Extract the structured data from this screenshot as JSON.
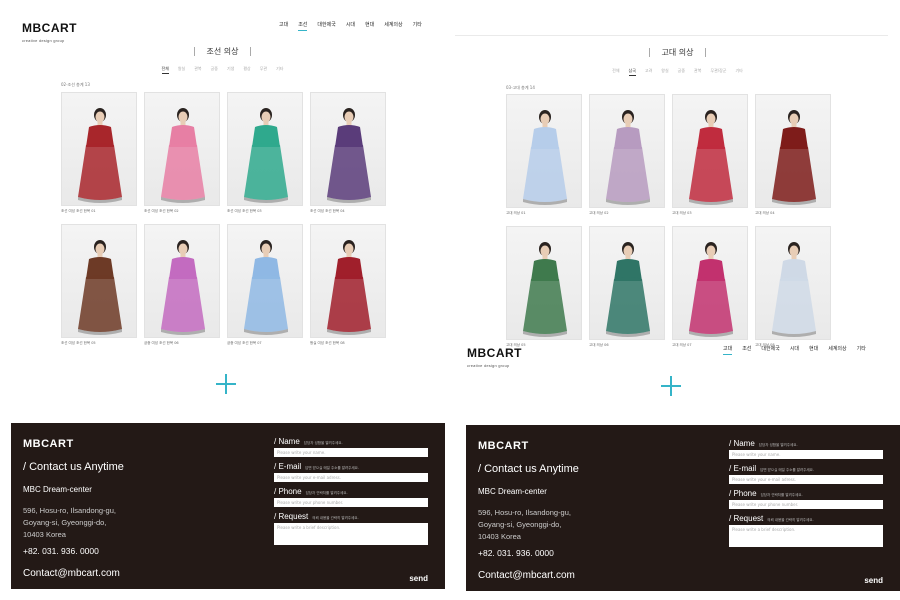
{
  "left": {
    "logo": {
      "brand": "MBCART",
      "sub": "creative design group"
    },
    "nav": [
      {
        "label": "고대",
        "active": false
      },
      {
        "label": "조선",
        "active": true
      },
      {
        "label": "대한제국",
        "active": false
      },
      {
        "label": "시대",
        "active": false
      },
      {
        "label": "현대",
        "active": false
      },
      {
        "label": "세계의상",
        "active": false
      },
      {
        "label": "기타",
        "active": false
      }
    ],
    "page_title": "조선 의상",
    "sub_tabs": [
      {
        "label": "전체",
        "active": true
      },
      {
        "label": "왕실",
        "active": false
      },
      {
        "label": "관복",
        "active": false
      },
      {
        "label": "궁중",
        "active": false
      },
      {
        "label": "기생",
        "active": false
      },
      {
        "label": "평상",
        "active": false
      },
      {
        "label": "무관",
        "active": false
      },
      {
        "label": "기타",
        "active": false
      }
    ],
    "count": "02-조선 총계 13",
    "items": [
      {
        "caption": "조선 여성 조선 한복 01",
        "color": "#a8262b"
      },
      {
        "caption": "조선 여성 조선 한복 02",
        "color": "#e77fa4"
      },
      {
        "caption": "조선 여성 조선 한복 03",
        "color": "#2fa98d"
      },
      {
        "caption": "조선 여성 조선 한복 04",
        "color": "#5a3c7a"
      },
      {
        "caption": "조선 여성 조선 한복 05",
        "color": "#6d3a26"
      },
      {
        "caption": "궁중 여성 조선 한복 06",
        "color": "#c36bc0"
      },
      {
        "caption": "궁중 여성 조선 한복 07",
        "color": "#8fb8e4"
      },
      {
        "caption": "왕실 여성 조선 한복 08",
        "color": "#a01f2b"
      }
    ]
  },
  "right": {
    "logo": {
      "brand": "MBCART",
      "sub": "creative design group"
    },
    "nav": [
      {
        "label": "고대",
        "active": true
      },
      {
        "label": "조선",
        "active": false
      },
      {
        "label": "대한제국",
        "active": false
      },
      {
        "label": "시대",
        "active": false
      },
      {
        "label": "현대",
        "active": false
      },
      {
        "label": "세계의상",
        "active": false
      },
      {
        "label": "기타",
        "active": false
      }
    ],
    "page_title": "고대 의상",
    "sub_tabs": [
      {
        "label": "전체",
        "active": false
      },
      {
        "label": "삼국",
        "active": true
      },
      {
        "label": "고려",
        "active": false
      },
      {
        "label": "왕실",
        "active": false
      },
      {
        "label": "궁중",
        "active": false
      },
      {
        "label": "관복",
        "active": false
      },
      {
        "label": "무관/장군",
        "active": false
      },
      {
        "label": "기타",
        "active": false
      }
    ],
    "count": "03-고대 총계 14",
    "items": [
      {
        "caption": "고대 의상 01",
        "color": "#b6cdea"
      },
      {
        "caption": "고대 의상 02",
        "color": "#b79bc0"
      },
      {
        "caption": "고대 의상 03",
        "color": "#c02c3e"
      },
      {
        "caption": "고대 의상 04",
        "color": "#7e1c1a"
      },
      {
        "caption": "고대 의상 05",
        "color": "#3f7a4d"
      },
      {
        "caption": "고대 의상 06",
        "color": "#2f7566"
      },
      {
        "caption": "고대 의상 07",
        "color": "#c2316e"
      },
      {
        "caption": "고대 의상 08",
        "color": "#cfd9e6"
      }
    ]
  },
  "footer": {
    "logo": "MBCART",
    "contact_title": "/ Contact us Anytime",
    "company": "MBC Dream-center",
    "address_lines": [
      "596, Hosu-ro, Ilsandong-gu,",
      "Goyang-si, Gyeonggi-do,",
      "10403 Korea"
    ],
    "phone": "+82. 031. 936. 0000",
    "email": "Contact@mbcart.com",
    "form": {
      "name_label": "/ Name",
      "name_hint": "담당자 성함을 알려주세요.",
      "name_placeholder": "Please write your name.",
      "email_label": "/ E-mail",
      "email_hint": "답변 받으실 메일 주소를 알려주세요.",
      "email_placeholder": "Please write your e-mail adress.",
      "phone_label": "/ Phone",
      "phone_hint": "담당자 연락처를 알려주세요.",
      "phone_placeholder": "Please write your phone number.",
      "request_label": "/ Request",
      "request_hint": "의뢰 내용을 간략히 알려주세요.",
      "request_placeholder": "Please write a brief description.",
      "send_label": "send"
    }
  },
  "colors": {
    "accent": "#35b4c8",
    "footer_bg": "#231916"
  }
}
